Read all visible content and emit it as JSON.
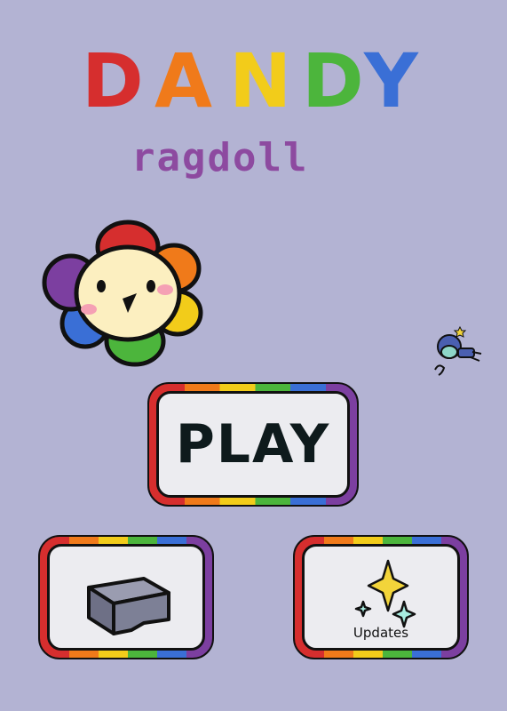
{
  "title": {
    "letters": [
      {
        "char": "D",
        "color": "#d62e2e"
      },
      {
        "char": "A",
        "color": "#f07a1a"
      },
      {
        "char": "N",
        "color": "#f2cc1a"
      },
      {
        "char": "D",
        "color": "#4cb53c"
      },
      {
        "char": "Y",
        "color": "#3a6fd6"
      }
    ],
    "subtitle": "ragdoll",
    "subtitle_color": "#8d4aa0"
  },
  "buttons": {
    "play_label": "PLAY",
    "updates_label": "Updates"
  },
  "icons": {
    "mascot": "rainbow-flower-mascot-icon",
    "shop": "gray-box-icon",
    "updates": "sparkles-icon",
    "character": "floating-astronaut-character-icon"
  },
  "rainbow": [
    "#d62e2e",
    "#f07a1a",
    "#f2cc1a",
    "#4cb53c",
    "#3a6fd6",
    "#7c3fa0"
  ]
}
